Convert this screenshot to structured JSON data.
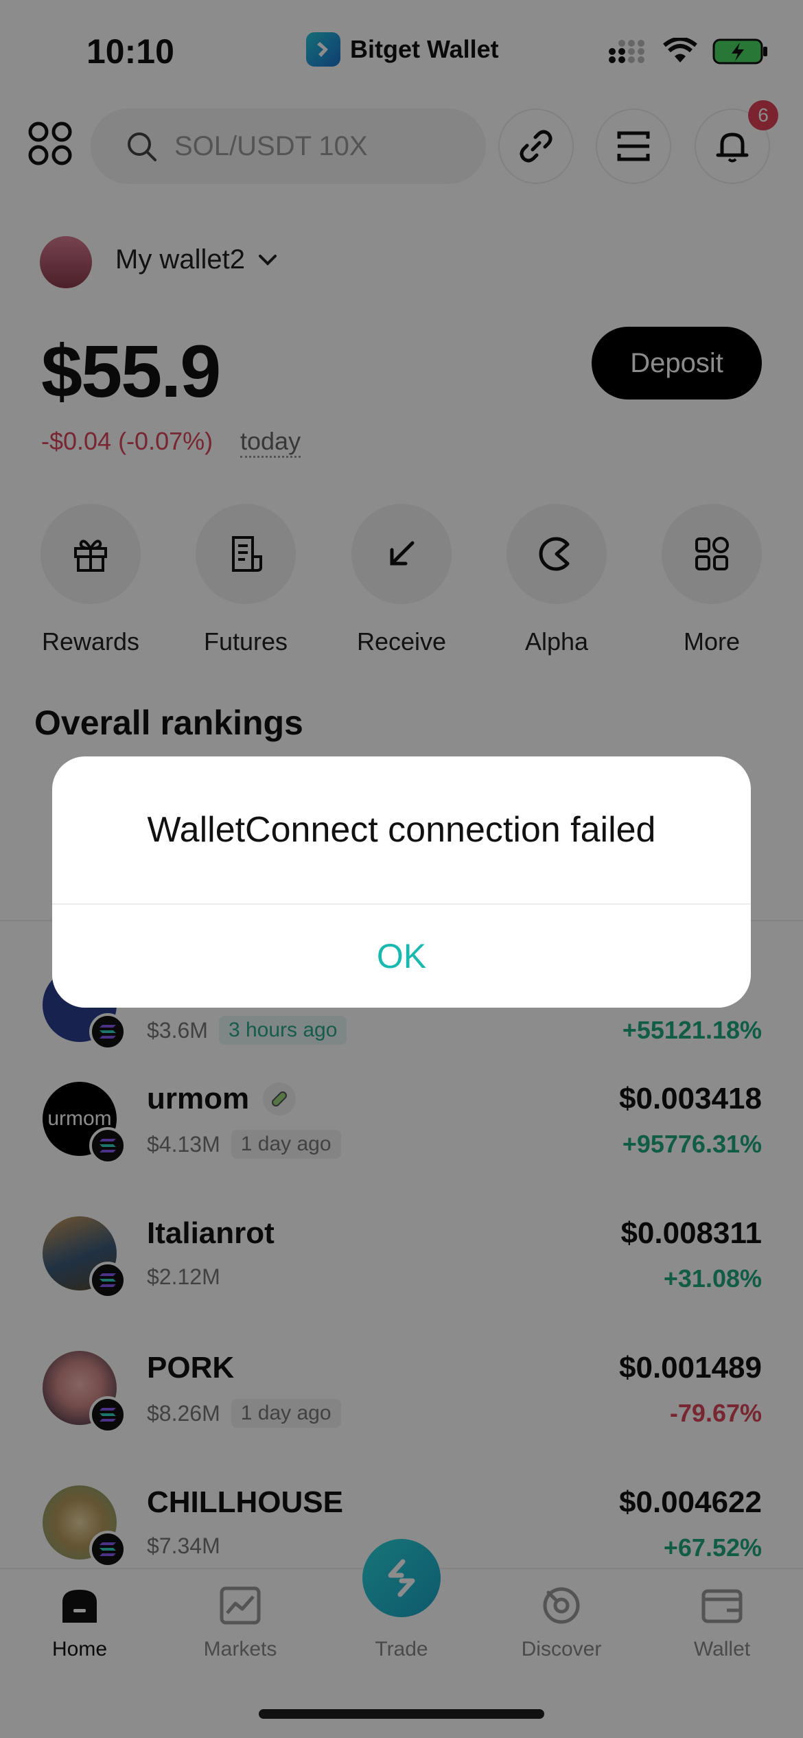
{
  "status_bar": {
    "time": "10:10",
    "app_name": "Bitget Wallet"
  },
  "top_bar": {
    "search_placeholder": "SOL/USDT 10X",
    "notification_count": "6"
  },
  "wallet": {
    "name": "My wallet2",
    "balance": "$55.9",
    "change": "-$0.04 (-0.07%)",
    "change_period": "today",
    "deposit_label": "Deposit"
  },
  "actions": [
    {
      "label": "Rewards",
      "icon": "gift-icon"
    },
    {
      "label": "Futures",
      "icon": "document-icon"
    },
    {
      "label": "Receive",
      "icon": "arrow-down-left-icon"
    },
    {
      "label": "Alpha",
      "icon": "alpha-icon"
    },
    {
      "label": "More",
      "icon": "grid-icon"
    }
  ],
  "rankings": {
    "title": "Overall rankings",
    "partial_row": {
      "market_cap": "$3.6M",
      "age": "3 hours ago",
      "change": "+55121.18%"
    },
    "tokens": [
      {
        "name": "urmom",
        "market_cap": "$4.13M",
        "age": "1 day ago",
        "price": "$0.003418",
        "change": "+95776.31%",
        "direction": "up"
      },
      {
        "name": "Italianrot",
        "market_cap": "$2.12M",
        "age": "",
        "price": "$0.008311",
        "change": "+31.08%",
        "direction": "up"
      },
      {
        "name": "PORK",
        "market_cap": "$8.26M",
        "age": "1 day ago",
        "price": "$0.001489",
        "change": "-79.67%",
        "direction": "down"
      },
      {
        "name": "CHILLHOUSE",
        "market_cap": "$7.34M",
        "age": "",
        "price": "$0.004622",
        "change": "+67.52%",
        "direction": "up"
      }
    ]
  },
  "nav": {
    "items": [
      {
        "label": "Home",
        "icon": "home-icon",
        "active": true
      },
      {
        "label": "Markets",
        "icon": "chart-icon",
        "active": false
      },
      {
        "label": "Trade",
        "icon": "trade-icon",
        "active": false
      },
      {
        "label": "Discover",
        "icon": "discover-icon",
        "active": false
      },
      {
        "label": "Wallet",
        "icon": "wallet-icon",
        "active": false
      }
    ]
  },
  "dialog": {
    "message": "WalletConnect connection failed",
    "ok_label": "OK"
  },
  "colors": {
    "accent": "#1ab9b0",
    "up": "#1fa87f",
    "down": "#d9455c"
  }
}
